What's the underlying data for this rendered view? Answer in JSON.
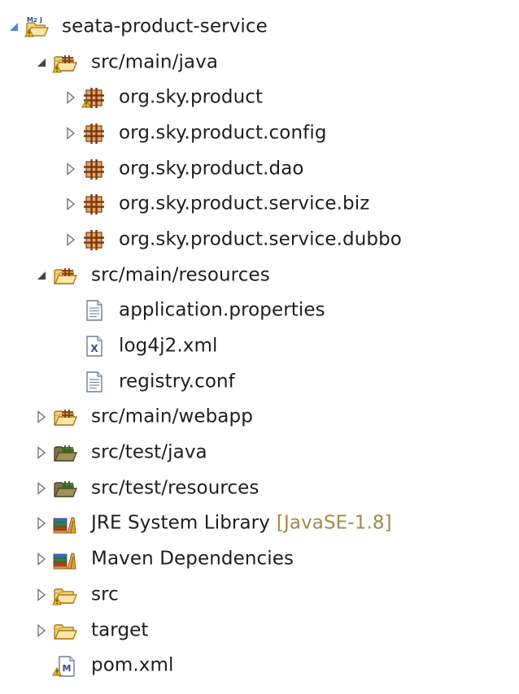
{
  "tree": {
    "project": {
      "label": "seata-product-service",
      "icon": "maven-java-project-icon",
      "expanded": true
    },
    "src_main_java": {
      "label": "src/main/java",
      "icon": "source-folder-icon",
      "expanded": true,
      "packages": [
        {
          "label": "org.sky.product",
          "icon": "package-warning-icon"
        },
        {
          "label": "org.sky.product.config",
          "icon": "package-icon"
        },
        {
          "label": "org.sky.product.dao",
          "icon": "package-icon"
        },
        {
          "label": "org.sky.product.service.biz",
          "icon": "package-icon"
        },
        {
          "label": "org.sky.product.service.dubbo",
          "icon": "package-icon"
        }
      ]
    },
    "src_main_resources": {
      "label": "src/main/resources",
      "icon": "source-folder-icon",
      "expanded": true,
      "files": [
        {
          "label": "application.properties",
          "icon": "text-file-icon"
        },
        {
          "label": "log4j2.xml",
          "icon": "xml-file-icon"
        },
        {
          "label": "registry.conf",
          "icon": "text-file-icon"
        }
      ]
    },
    "src_main_webapp": {
      "label": "src/main/webapp",
      "icon": "source-folder-icon"
    },
    "src_test_java": {
      "label": "src/test/java",
      "icon": "test-source-folder-icon"
    },
    "src_test_resources": {
      "label": "src/test/resources",
      "icon": "test-source-folder-icon"
    },
    "jre_library": {
      "label": "JRE System Library",
      "decoration": "[JavaSE-1.8]",
      "icon": "library-icon"
    },
    "maven_dependencies": {
      "label": "Maven Dependencies",
      "icon": "library-icon"
    },
    "src_folder": {
      "label": "src",
      "icon": "folder-warning-icon"
    },
    "target_folder": {
      "label": "target",
      "icon": "folder-icon"
    },
    "pom": {
      "label": "pom.xml",
      "icon": "maven-pom-icon"
    }
  },
  "colors": {
    "text": "#1e1e1e",
    "decoration": "#a08a4a",
    "expander": "#5a5a5a",
    "folder_fill": "#f7d98e",
    "folder_stroke": "#b8862b",
    "package": "#9c5420",
    "test_folder": "#6e6a3c"
  }
}
